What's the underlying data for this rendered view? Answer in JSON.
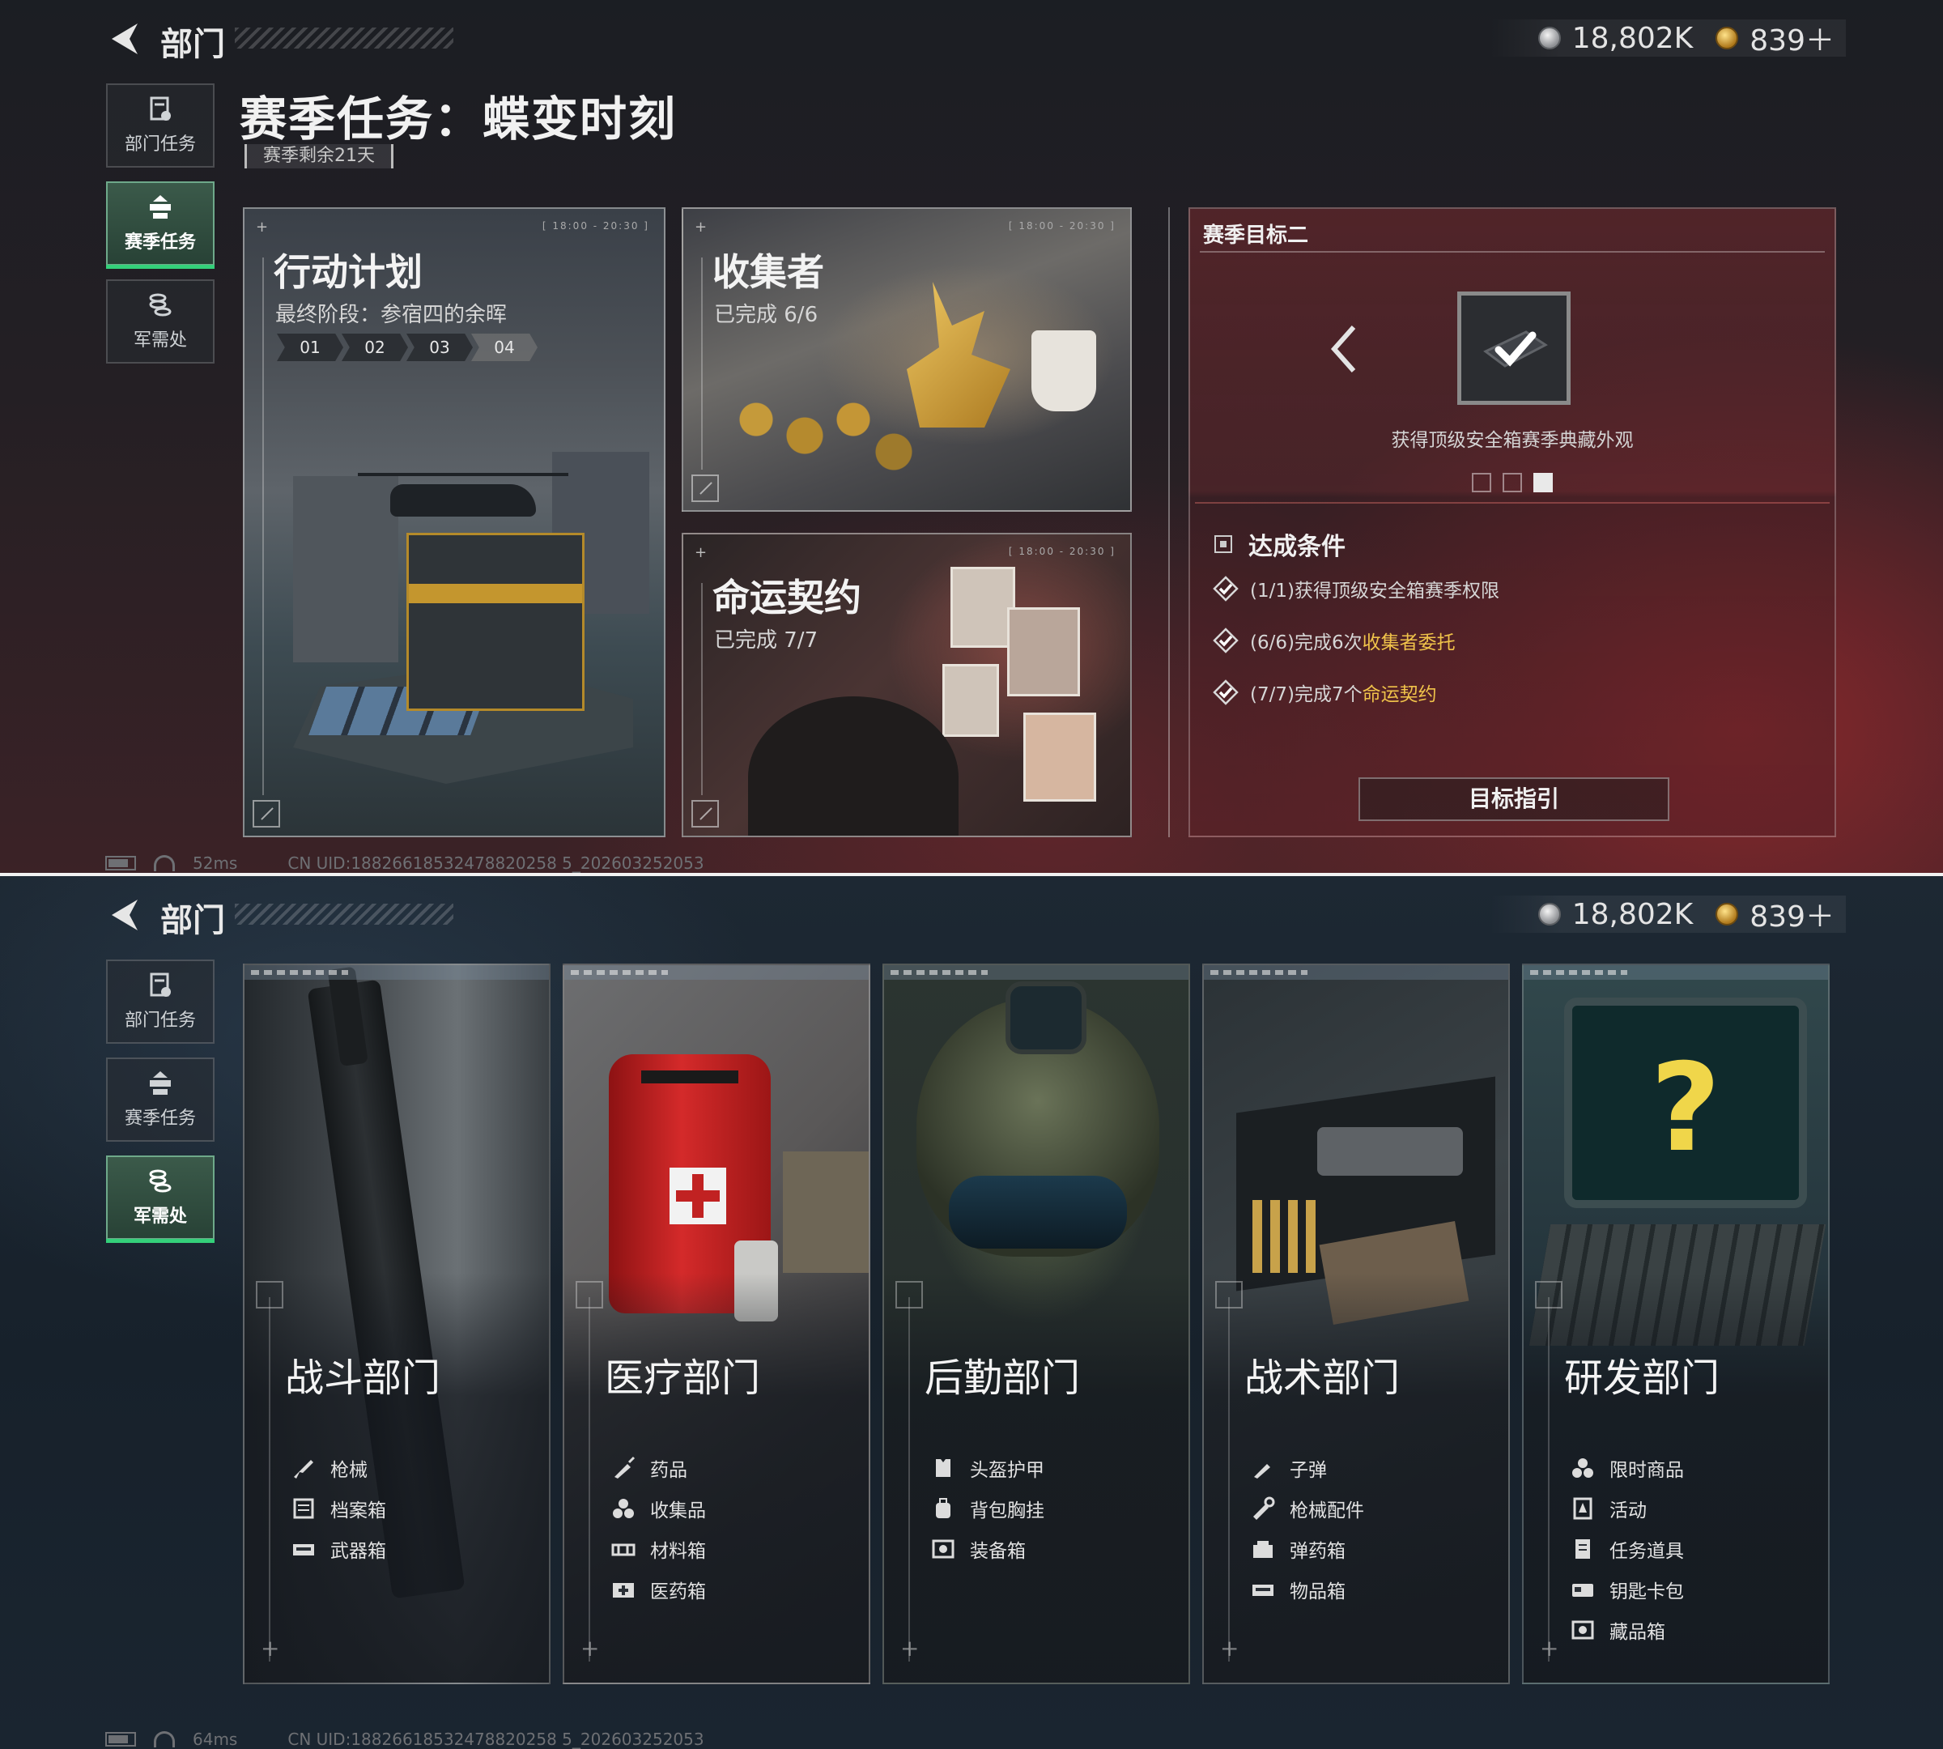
{
  "header": {
    "title": "部门",
    "currency": [
      {
        "icon": "silver-coin-icon",
        "value": "18,802K"
      },
      {
        "icon": "gold-coin-icon",
        "value": "839＋"
      }
    ]
  },
  "sidebar": {
    "items": [
      {
        "label": "部门任务",
        "icon": "department-task-icon"
      },
      {
        "label": "赛季任务",
        "icon": "season-task-icon"
      },
      {
        "label": "军需处",
        "icon": "quartermaster-icon"
      }
    ]
  },
  "season": {
    "title": "赛季任务：蝶变时刻",
    "remaining": "赛季剩余21天",
    "cards": {
      "action": {
        "title": "行动计划",
        "subtitle": "最终阶段：参宿四的余晖",
        "meta": "[ 18:00 - 20:30 ]",
        "stages": [
          "01",
          "02",
          "03",
          "04"
        ]
      },
      "collector": {
        "title": "收集者",
        "subtitle": "已完成 6/6",
        "meta": "[ 18:00 - 20:30 ]"
      },
      "fate": {
        "title": "命运契约",
        "subtitle": "已完成 7/7",
        "meta": "[ 18:00 - 20:30 ]"
      }
    },
    "goal": {
      "header": "赛季目标二",
      "reward_caption": "获得顶级安全箱赛季典藏外观",
      "page_dots": 3,
      "active_dot": 2,
      "conditions_title": "达成条件",
      "conditions": [
        {
          "prefix": "(1/1)获得顶级安全箱赛季权限",
          "highlight": ""
        },
        {
          "prefix": "(6/6)完成6次",
          "highlight": "收集者委托"
        },
        {
          "prefix": "(7/7)完成7个",
          "highlight": "命运契约"
        }
      ],
      "guide_button": "目标指引"
    }
  },
  "status_top": {
    "ping": "52ms",
    "uid": "CN UID:18826618532478820258 5_202603252053"
  },
  "status_bottom": {
    "ping": "64ms",
    "uid": "CN UID:18826618532478820258 5_202603252053"
  },
  "departments": [
    {
      "name": "战斗部门",
      "items": [
        {
          "icon": "gun-icon",
          "label": "枪械"
        },
        {
          "icon": "file-box-icon",
          "label": "档案箱"
        },
        {
          "icon": "weapon-case-icon",
          "label": "武器箱"
        }
      ]
    },
    {
      "name": "医疗部门",
      "items": [
        {
          "icon": "syringe-icon",
          "label": "药品"
        },
        {
          "icon": "collectible-icon",
          "label": "收集品"
        },
        {
          "icon": "material-box-icon",
          "label": "材料箱"
        },
        {
          "icon": "medical-box-icon",
          "label": "医药箱"
        }
      ]
    },
    {
      "name": "后勤部门",
      "items": [
        {
          "icon": "armor-icon",
          "label": "头盔护甲"
        },
        {
          "icon": "backpack-icon",
          "label": "背包胸挂"
        },
        {
          "icon": "equipment-box-icon",
          "label": "装备箱"
        }
      ]
    },
    {
      "name": "战术部门",
      "items": [
        {
          "icon": "bullet-icon",
          "label": "子弹"
        },
        {
          "icon": "gun-part-icon",
          "label": "枪械配件"
        },
        {
          "icon": "ammo-box-icon",
          "label": "弹药箱"
        },
        {
          "icon": "item-box-icon",
          "label": "物品箱"
        }
      ]
    },
    {
      "name": "研发部门",
      "items": [
        {
          "icon": "limited-goods-icon",
          "label": "限时商品"
        },
        {
          "icon": "event-icon",
          "label": "活动"
        },
        {
          "icon": "task-item-icon",
          "label": "任务道具"
        },
        {
          "icon": "keycard-icon",
          "label": "钥匙卡包"
        },
        {
          "icon": "collection-box-icon",
          "label": "藏品箱"
        }
      ]
    }
  ]
}
